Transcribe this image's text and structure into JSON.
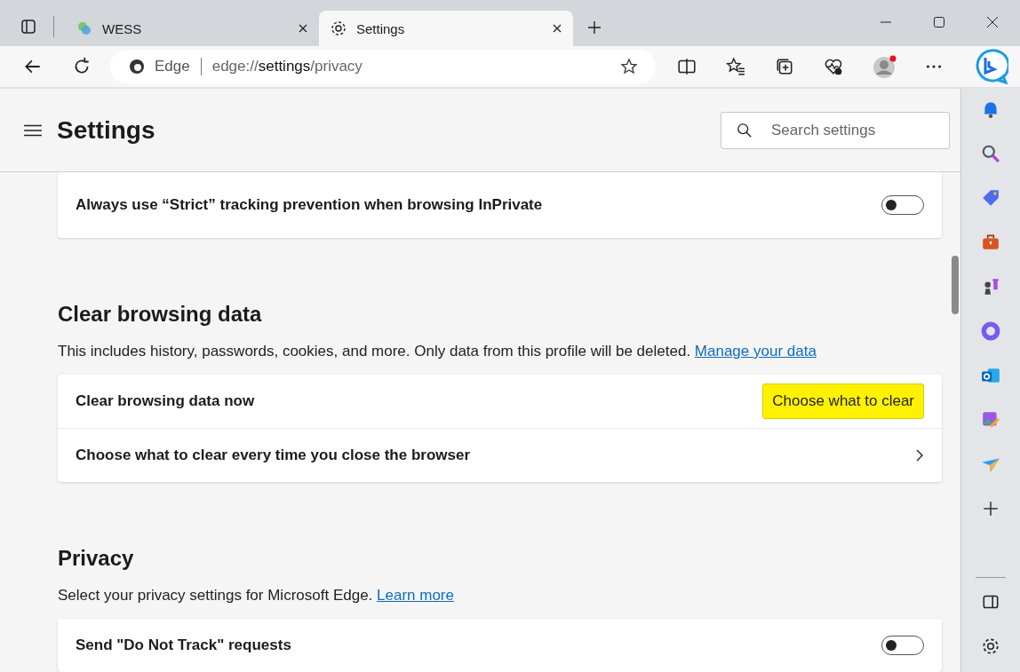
{
  "tabs": [
    {
      "title": "WESS",
      "selected": false
    },
    {
      "title": "Settings",
      "selected": true
    }
  ],
  "address": {
    "site_label": "Edge",
    "scheme": "edge://",
    "host": "settings",
    "path": "/privacy"
  },
  "page": {
    "title": "Settings",
    "search": {
      "placeholder": "Search settings"
    }
  },
  "sections": [
    {
      "rows": [
        {
          "kind": "toggle",
          "label": "Always use “Strict” tracking prevention when browsing InPrivate",
          "on": false
        }
      ]
    },
    {
      "heading": "Clear browsing data",
      "description": "This includes history, passwords, cookies, and more. Only data from this profile will be deleted.",
      "link": "Manage your data",
      "rows": [
        {
          "kind": "button",
          "label": "Clear browsing data now",
          "button": "Choose what to clear",
          "highlighted": true
        },
        {
          "kind": "chevron",
          "label": "Choose what to clear every time you close the browser"
        }
      ]
    },
    {
      "heading": "Privacy",
      "description": "Select your privacy settings for Microsoft Edge.",
      "link": "Learn more",
      "rows": [
        {
          "kind": "toggle",
          "label": "Send \"Do Not Track\" requests",
          "on": false
        }
      ]
    }
  ]
}
